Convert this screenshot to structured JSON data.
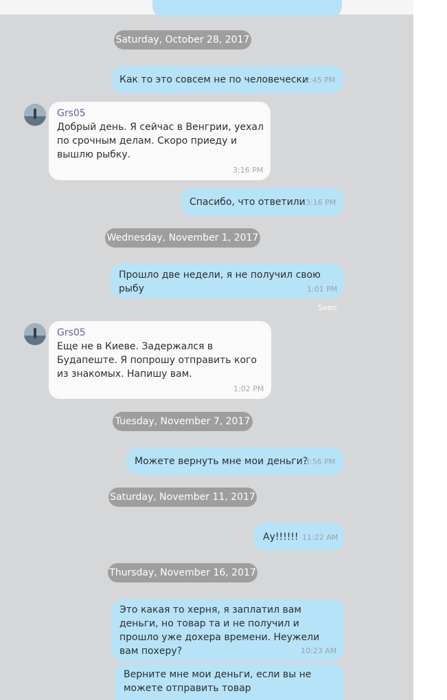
{
  "conversation": {
    "contact_name": "Grs05",
    "dates": {
      "d1": "Saturday, October 28, 2017",
      "d2": "Wednesday, November 1, 2017",
      "d3": "Tuesday, November 7, 2017",
      "d4": "Saturday, November 11, 2017",
      "d5": "Thursday, November 16, 2017"
    },
    "messages": {
      "m1": {
        "text": "Как то это совсем не по человечески",
        "time": "2:45 PM"
      },
      "m2": {
        "text": "Добрый день. Я сейчас в Венгрии, уехал по срочным делам. Скоро приеду и вышлю рыбку.",
        "time": "3:16 PM"
      },
      "m3": {
        "text": "Спасибо, что ответили",
        "time": "3:16 PM"
      },
      "m4": {
        "text": "Прошло две недели, я не получил свою рыбу",
        "time": "1:01 PM",
        "status": "Seen"
      },
      "m5": {
        "text": "Еще не в Киеве. Задержался в Будапеште. Я попрошу отправить кого из знакомых. Напишу вам.",
        "time": "1:02 PM"
      },
      "m6": {
        "text": "Можете вернуть мне мои деньги?",
        "time": "3:56 PM"
      },
      "m7": {
        "text": "Ау!!!!!!",
        "time": "11:22 AM"
      },
      "m8": {
        "text": "Это какая то херня, я заплатил вам деньги, но товар та и не получил и прошло уже дохера времени. Неужели вам похеру?",
        "time": "10:23 AM"
      },
      "m9": {
        "text": "Верните мне мои деньги, если вы не можете отправить товар",
        "time": ""
      }
    }
  },
  "colors": {
    "background": "#d6d7d8",
    "outgoing_bubble": "#b6e3f7",
    "incoming_bubble": "#fafafa",
    "date_pill": "#9e9e9e",
    "sender_name": "#6b5c9e"
  }
}
